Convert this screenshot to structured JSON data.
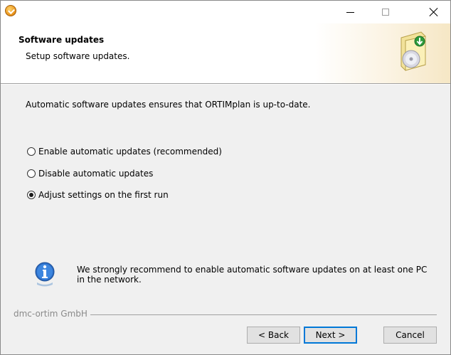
{
  "window": {
    "title": "",
    "controls": {
      "minimize": "minimize-icon",
      "maximize": "maximize-icon",
      "close": "close-icon"
    }
  },
  "header": {
    "title": "Software updates",
    "subtitle": "Setup software updates."
  },
  "main": {
    "intro": "Automatic software updates ensures that ORTIMplan is up-to-date.",
    "options": [
      {
        "label": "Enable automatic updates (recommended)",
        "selected": false
      },
      {
        "label": "Disable automatic updates",
        "selected": false
      },
      {
        "label": "Adjust settings on the first run",
        "selected": true
      }
    ],
    "info": "We strongly recommend to enable automatic software updates on at least one PC in the network."
  },
  "footer": {
    "brand": "dmc-ortim GmbH",
    "back_label": "< Back",
    "next_label": "Next >",
    "cancel_label": "Cancel"
  },
  "colors": {
    "focus": "#0078d7",
    "dialog_bg": "#f0f0f0"
  }
}
